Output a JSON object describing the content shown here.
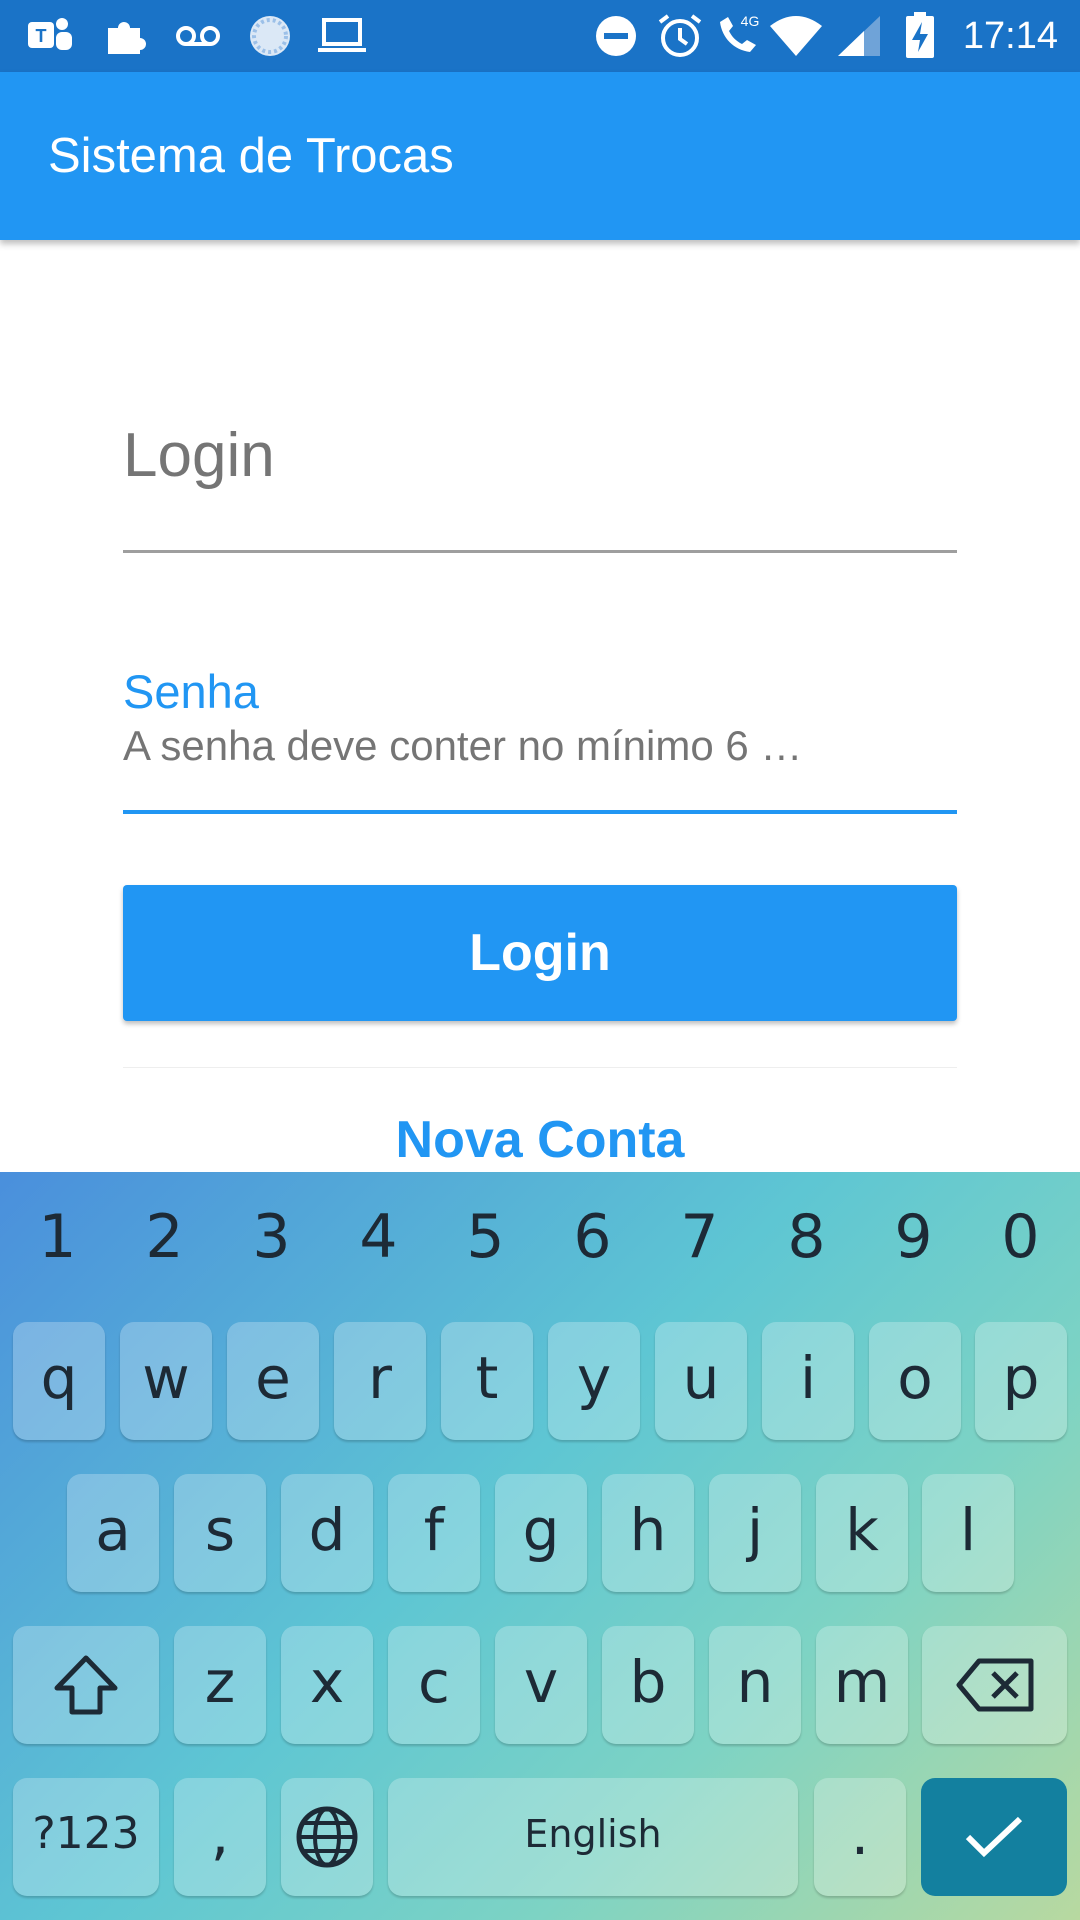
{
  "status_bar": {
    "time": "17:14",
    "left_icons": [
      "teams-icon",
      "puzzle-icon",
      "voicemail-icon",
      "loading-icon",
      "laptop-icon"
    ],
    "right_icons": [
      "dnd-icon",
      "alarm-icon",
      "call-4g-icon",
      "wifi-icon",
      "signal-icon",
      "battery-charging-icon"
    ],
    "network_label": "4G"
  },
  "app_bar": {
    "title": "Sistema de Trocas"
  },
  "form": {
    "login_placeholder": "Login",
    "senha_label": "Senha",
    "senha_hint": "A senha deve conter no mínimo 6 …",
    "login_button": "Login",
    "secondary_button": "Nova Conta"
  },
  "keyboard": {
    "numbers": [
      "1",
      "2",
      "3",
      "4",
      "5",
      "6",
      "7",
      "8",
      "9",
      "0"
    ],
    "row1": [
      "q",
      "w",
      "e",
      "r",
      "t",
      "y",
      "u",
      "i",
      "o",
      "p"
    ],
    "row2": [
      "a",
      "s",
      "d",
      "f",
      "g",
      "h",
      "j",
      "k",
      "l"
    ],
    "row3": [
      "z",
      "x",
      "c",
      "v",
      "b",
      "n",
      "m"
    ],
    "symbols_label": "?123",
    "comma_label": ",",
    "space_label": "English",
    "period_label": ".",
    "colors": {
      "enter": "#13809f",
      "accent": "#2196f3"
    }
  }
}
